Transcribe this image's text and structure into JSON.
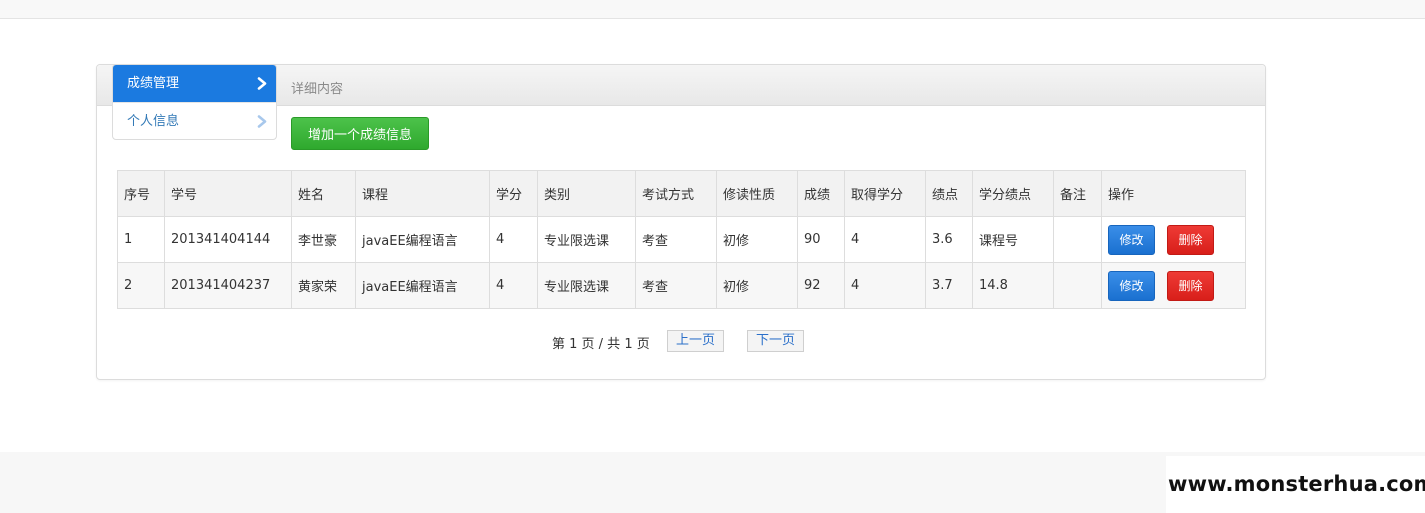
{
  "sidebar": {
    "items": [
      {
        "label": "成绩管理",
        "active": true
      },
      {
        "label": "个人信息",
        "active": false
      }
    ]
  },
  "panel": {
    "title": "详细内容",
    "add_button_label": "增加一个成绩信息"
  },
  "table": {
    "headers": [
      "序号",
      "学号",
      "姓名",
      "课程",
      "学分",
      "类别",
      "考试方式",
      "修读性质",
      "成绩",
      "取得学分",
      "绩点",
      "学分绩点",
      "备注",
      "操作"
    ],
    "rows": [
      {
        "index": "1",
        "student_id": "201341404144",
        "name": "李世豪",
        "course": "javaEE编程语言",
        "credit": "4",
        "category": "专业限选课",
        "exam_method": "考查",
        "study_type": "初修",
        "score": "90",
        "earned_credit": "4",
        "gpa": "3.6",
        "credit_gpa": "课程号",
        "remark": ""
      },
      {
        "index": "2",
        "student_id": "201341404237",
        "name": "黄家荣",
        "course": "javaEE编程语言",
        "credit": "4",
        "category": "专业限选课",
        "exam_method": "考查",
        "study_type": "初修",
        "score": "92",
        "earned_credit": "4",
        "gpa": "3.7",
        "credit_gpa": "14.8",
        "remark": ""
      }
    ],
    "edit_label": "修改",
    "delete_label": "删除"
  },
  "pager": {
    "info": "第 1 页 / 共 1 页",
    "prev_label": "上一页",
    "next_label": "下一页"
  },
  "watermark": "www.monsterhua.com",
  "colors": {
    "primary": "#1b7ae0",
    "success": "#2fa92e",
    "danger": "#d81f1a"
  }
}
